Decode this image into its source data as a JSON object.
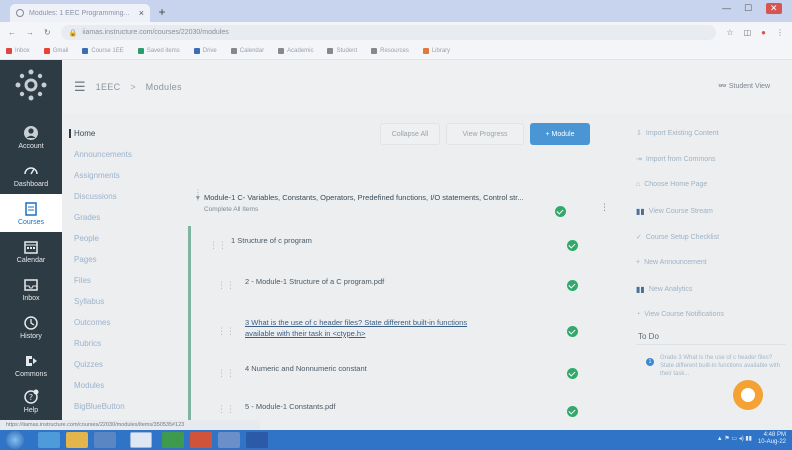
{
  "browser": {
    "tab_title": "Modules: 1 EEC Programming...",
    "tab_close": "×",
    "new_tab": "+",
    "url": "iiamas.instructure.com/courses/22030/modules",
    "bookmarks": [
      "Inbox",
      "Gmail",
      "Course 1EE",
      "Saved items",
      "Drive",
      "Calendar",
      "Academic",
      "Student",
      "Resources",
      "Library"
    ],
    "window_controls": [
      "—",
      "☐",
      "✕"
    ]
  },
  "global_nav": {
    "items": [
      {
        "label": "Account",
        "icon": "user-icon"
      },
      {
        "label": "Dashboard",
        "icon": "dashboard-icon"
      },
      {
        "label": "Courses",
        "icon": "book-icon"
      },
      {
        "label": "Calendar",
        "icon": "calendar-icon"
      },
      {
        "label": "Inbox",
        "icon": "inbox-icon"
      },
      {
        "label": "History",
        "icon": "clock-icon"
      },
      {
        "label": "Commons",
        "icon": "commons-icon"
      },
      {
        "label": "Help",
        "icon": "help-icon"
      }
    ]
  },
  "header": {
    "course": "1EEC",
    "separator": ">",
    "page": "Modules",
    "student_view": "Student View"
  },
  "course_nav": {
    "items": [
      {
        "label": "Home"
      },
      {
        "label": "Announcements"
      },
      {
        "label": "Assignments"
      },
      {
        "label": "Discussions"
      },
      {
        "label": "Grades"
      },
      {
        "label": "People"
      },
      {
        "label": "Pages"
      },
      {
        "label": "Files"
      },
      {
        "label": "Syllabus"
      },
      {
        "label": "Outcomes"
      },
      {
        "label": "Rubrics"
      },
      {
        "label": "Quizzes"
      },
      {
        "label": "Modules"
      },
      {
        "label": "BigBlueButton"
      }
    ]
  },
  "toolbar": {
    "collapse_all": "Collapse All",
    "view_progress": "View Progress",
    "add_module": "+ Module"
  },
  "module": {
    "title": "Module-1 C- Variables, Constants, Operators, Predefined functions, I/O statements, Control str...",
    "collapse_label": "Complete All Items",
    "items": [
      {
        "title": "1 Structure of c program",
        "sub": "",
        "link": false
      },
      {
        "title": "2 - Module-1 Structure of a C program.pdf",
        "sub": "",
        "link": false
      },
      {
        "title_line1": "3 What is the use of c header files? State different built-in functions",
        "title_line2": "available with their task in <ctype.h>",
        "sub": "",
        "link": true
      },
      {
        "title": "4 Numeric and Nonnumeric constant",
        "sub": "",
        "link": false
      },
      {
        "title": "5 - Module-1 Constants.pdf",
        "sub": "",
        "link": false
      }
    ]
  },
  "sidebar": {
    "links": [
      {
        "label": "Import Existing Content",
        "icon": ""
      },
      {
        "label": "Import from Commons",
        "icon": ""
      },
      {
        "label": "Choose Home Page",
        "icon": ""
      },
      {
        "label": "View Course Stream",
        "icon": "bar-chart-icon"
      },
      {
        "label": "Course Setup Checklist",
        "icon": ""
      },
      {
        "label": "New Announcement",
        "icon": ""
      },
      {
        "label": "New Analytics",
        "icon": "bar-chart-icon"
      },
      {
        "label": "View Course Notifications",
        "icon": ""
      }
    ],
    "todo_heading": "To Do",
    "todo_count": "1",
    "todo_text": "Grade 3 What is the use of c header files? State different built-in functions available with their task..."
  },
  "status_url": "https://iiamas.instructure.com/courses/22030/modules/items/350535#123",
  "taskbar": {
    "clock_time": "4:48 PM",
    "clock_date": "10-Aug-22"
  }
}
